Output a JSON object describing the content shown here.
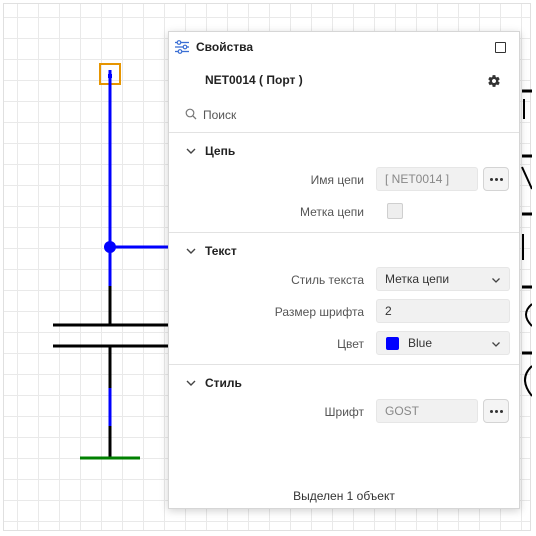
{
  "panel": {
    "title": "Свойства",
    "subtitle": "NET0014 ( Порт )",
    "search_placeholder": "Поиск",
    "sections": {
      "net": {
        "title": "Цепь",
        "net_name_label": "Имя цепи",
        "net_name_value": "[ NET0014 ]",
        "net_label_label": "Метка цепи",
        "net_label_checked": false
      },
      "text": {
        "title": "Текст",
        "text_style_label": "Стиль текста",
        "text_style_value": "Метка цепи",
        "font_size_label": "Размер шрифта",
        "font_size_value": "2",
        "color_label": "Цвет",
        "color_value": "Blue",
        "color_hex": "#0000ff"
      },
      "style": {
        "title": "Стиль",
        "font_label": "Шрифт",
        "font_value": "GOST"
      }
    },
    "status": "Выделен 1 объект"
  },
  "icons": {
    "panel": "sliders-icon",
    "maximize": "square-icon",
    "settings": "gear-icon",
    "search": "search-icon",
    "collapse": "chevron-down-icon",
    "dropdown": "chevron-down-icon",
    "more": "ellipsis-icon"
  },
  "colors": {
    "wire_selected": "#0000ff",
    "wire": "#000000",
    "ground": "#008000",
    "port_marker": "#e69500"
  }
}
